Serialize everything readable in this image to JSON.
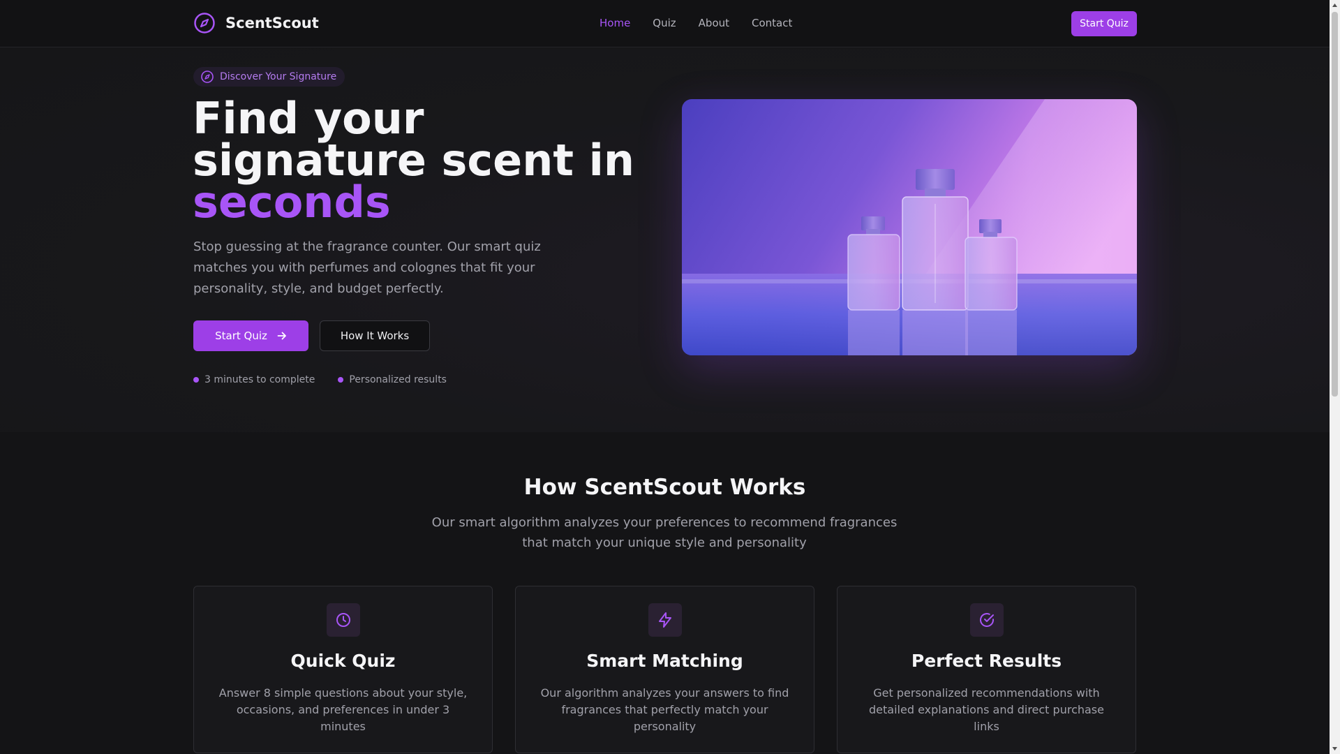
{
  "brand": {
    "name": "ScentScout",
    "icon": "compass-icon"
  },
  "nav": {
    "items": [
      "Home",
      "Quiz",
      "About",
      "Contact"
    ],
    "active": "Home"
  },
  "header": {
    "cta_label": "Start Quiz"
  },
  "hero": {
    "badge": "Discover Your Signature",
    "headline_line1": "Find your",
    "headline_line2": "signature scent in",
    "headline_accent": "seconds",
    "description": "Stop guessing at the fragrance counter. Our smart quiz matches you with perfumes and colognes that fit your personality, style, and budget perfectly.",
    "primary_button": "Start Quiz",
    "secondary_button": "How It Works",
    "points": [
      "3 minutes to complete",
      "Personalized results"
    ]
  },
  "how_it_works": {
    "title": "How ScentScout Works",
    "subtitle": "Our smart algorithm analyzes your preferences to recommend fragrances that match your unique style and personality",
    "cards": [
      {
        "icon": "clock-icon",
        "title": "Quick Quiz",
        "text": "Answer 8 simple questions about your style, occasions, and preferences in under 3 minutes"
      },
      {
        "icon": "lightning-icon",
        "title": "Smart Matching",
        "text": "Our algorithm analyzes your answers to find fragrances that perfectly match your personality"
      },
      {
        "icon": "check-circle-icon",
        "title": "Perfect Results",
        "text": "Get personalized recommendations with detailed explanations and direct purchase links"
      }
    ]
  },
  "colors": {
    "accent": "#a855f7",
    "button": "#9d3fe7",
    "background": "#141416",
    "muted_text": "#a1a1aa"
  }
}
